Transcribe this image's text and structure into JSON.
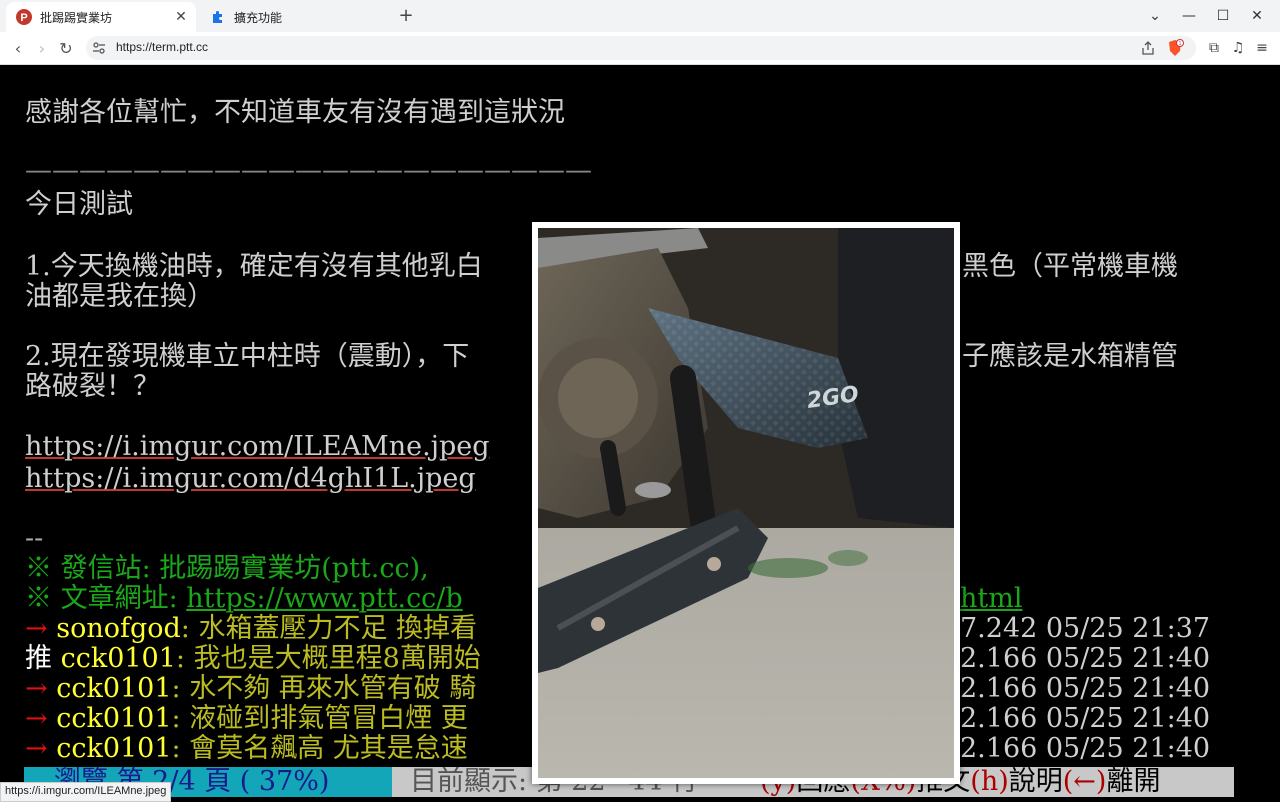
{
  "browser": {
    "tabs": [
      {
        "title": "批踢踢實業坊",
        "active": true
      },
      {
        "title": "擴充功能",
        "active": false
      }
    ],
    "url": "https://term.ptt.cc",
    "hover_url": "https://i.imgur.com/ILEAMne.jpeg"
  },
  "article": {
    "line1": "感謝各位幫忙，不知道車友有沒有遇到這狀況",
    "divider": "—————————————————————",
    "today": "今日測試",
    "item1_a": "1.今天換機油時，確定有沒有其他乳白",
    "item1_b": "黑色（平常機車機",
    "item1_c": "油都是我在換）",
    "item2_a": "2.現在發現機車立中柱時（震動），下",
    "item2_b": "子應該是水箱精管",
    "item2_c": "路破裂！？",
    "link1": "https://i.imgur.com/ILEAMne.jpeg",
    "link2": "https://i.imgur.com/d4ghI1L.jpeg",
    "sig_dash": "--",
    "sig_site": "※ 發信站: 批踢踢實業坊(ptt.cc),",
    "sig_url_label": "※ 文章網址: ",
    "sig_url": "https://www.ptt.cc/b",
    "sig_url_tail": "html"
  },
  "pushes": [
    {
      "tag": "→",
      "user": "sonofgod",
      "text": ": 水箱蓋壓力不足 換掉看",
      "ip_time": "7.242 05/25 21:37"
    },
    {
      "tag": "推",
      "user": "cck0101",
      "text": ": 我也是大概里程8萬開始",
      "ip_time": "2.166 05/25 21:40"
    },
    {
      "tag": "→",
      "user": "cck0101",
      "text": ": 水不夠 再來水管有破 騎",
      "ip_time": "2.166 05/25 21:40"
    },
    {
      "tag": "→",
      "user": "cck0101",
      "text": ": 液碰到排氣管冒白煙 更",
      "ip_time": "2.166 05/25 21:40"
    },
    {
      "tag": "→",
      "user": "cck0101",
      "text": ": 會莫名飆高 尤其是怠速",
      "ip_time": "2.166 05/25 21:40"
    }
  ],
  "statusbar": {
    "left": "瀏覽 第 2/4 頁 ( 37%)",
    "middle": "目前顯示: 第 22~44 行",
    "right_y": "(y)",
    "right_reply": "回應",
    "right_x": "(X%)",
    "right_push": "推文",
    "right_h": "(h)",
    "right_help": "說明",
    "right_back": "(←)",
    "right_leave": "離開"
  },
  "colors": {
    "terminal_bg": "#000000",
    "status_accent": "#12a6b8",
    "push_arrow": "#dd1111",
    "push_user": "#ffff33"
  }
}
